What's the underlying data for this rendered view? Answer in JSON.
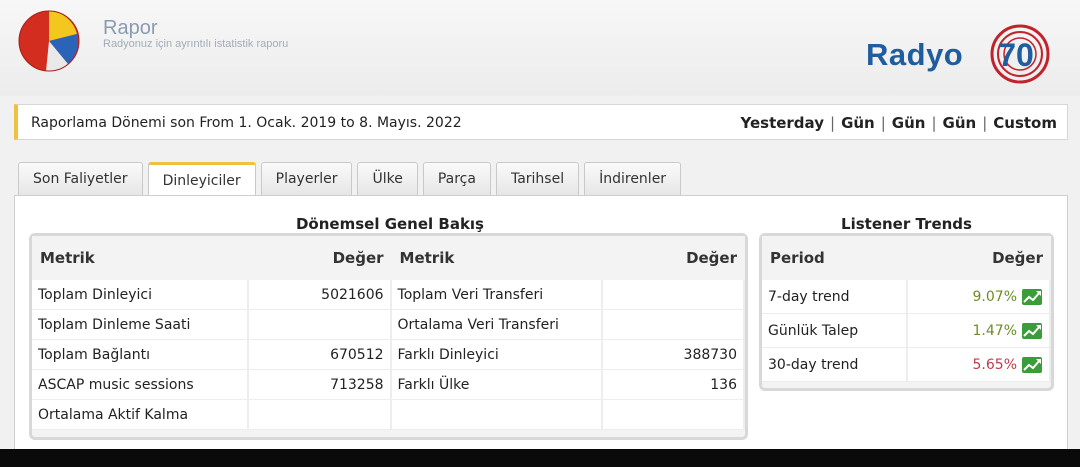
{
  "header": {
    "title": "Rapor",
    "subtitle": "Radyonuz için ayrıntılı istatistik raporu",
    "brand_text": "Radyo",
    "brand_number": "70",
    "colors": {
      "brand_blue": "#1f5d9e",
      "brand_red": "#c0232c"
    }
  },
  "period": {
    "text": "Raporlama Dönemi son From 1. Ocak. 2019 to 8. Mayıs. 2022",
    "links": [
      "Yesterday",
      "Gün",
      "Gün",
      "Gün",
      "Custom"
    ],
    "separator": "|"
  },
  "tabs": [
    {
      "label": "Son Faliyetler",
      "active": false
    },
    {
      "label": "Dinleyiciler",
      "active": true
    },
    {
      "label": "Playerler",
      "active": false
    },
    {
      "label": "Ülke",
      "active": false
    },
    {
      "label": "Parça",
      "active": false
    },
    {
      "label": "Tarihsel",
      "active": false
    },
    {
      "label": "İndirenler",
      "active": false
    }
  ],
  "overview": {
    "title": "Dönemsel Genel Bakış",
    "headers": [
      "Metrik",
      "Değer",
      "Metrik",
      "Değer"
    ],
    "rows": [
      [
        "Toplam Dinleyici",
        "5021606",
        "Toplam Veri Transferi",
        ""
      ],
      [
        "Toplam Dinleme Saati",
        "",
        "Ortalama Veri Transferi",
        ""
      ],
      [
        "Toplam Bağlantı",
        "670512",
        "Farklı Dinleyici",
        "388730"
      ],
      [
        "ASCAP music sessions",
        "713258",
        "Farklı Ülke",
        "136"
      ],
      [
        "Ortalama Aktif Kalma",
        "",
        "",
        ""
      ]
    ]
  },
  "trends": {
    "title": "Listener Trends",
    "headers": [
      "Period",
      "Değer"
    ],
    "rows": [
      {
        "period": "7-day trend",
        "value": "9.07%",
        "color": "#6b8e23",
        "icon": "trend-up-icon"
      },
      {
        "period": "Günlük Talep",
        "value": "1.47%",
        "color": "#6b8e23",
        "icon": "trend-up-icon"
      },
      {
        "period": "30-day trend",
        "value": "5.65%",
        "color": "#c03a4a",
        "icon": "trend-up-icon"
      }
    ]
  }
}
